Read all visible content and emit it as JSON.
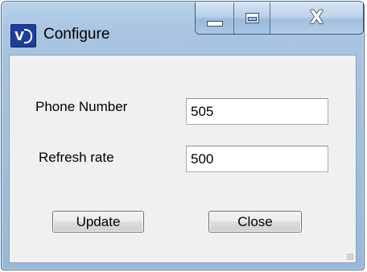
{
  "window": {
    "title": "Configure",
    "icon": "vd-app-icon",
    "icon_label": "VD"
  },
  "caption": {
    "minimize_icon": "minimize-icon",
    "maximize_icon": "maximize-icon",
    "close_label": "X"
  },
  "form": {
    "phone_label": "Phone Number",
    "phone_value": "505",
    "refresh_label": "Refresh rate",
    "refresh_value": "500"
  },
  "buttons": {
    "update_label": "Update",
    "close_label": "Close"
  },
  "colors": {
    "frame": "#a9c4e0",
    "client": "#f0f0f0",
    "icon_bg": "#1e3f9c"
  }
}
